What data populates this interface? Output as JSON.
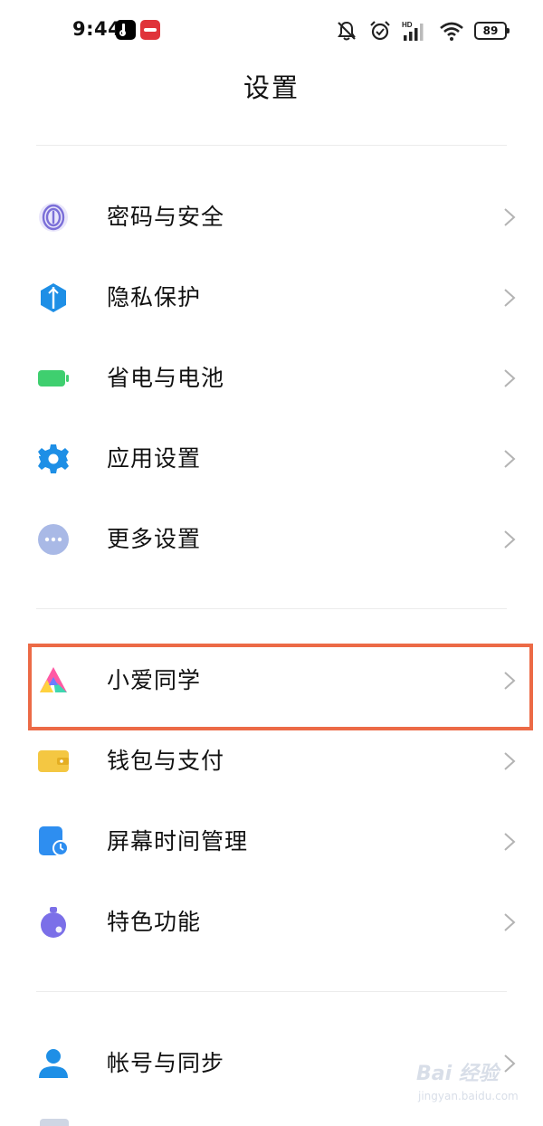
{
  "status_bar": {
    "time": "9:44",
    "battery_level": "89",
    "network_label": "HD",
    "icons": [
      "tiktok-icon",
      "app-icon",
      "mute-icon",
      "alarm-icon",
      "signal-icon",
      "wifi-icon",
      "battery-icon"
    ]
  },
  "header": {
    "title": "设置"
  },
  "settings": {
    "group1": [
      {
        "label": "密码与安全",
        "icon": "fingerprint-icon"
      },
      {
        "label": "隐私保护",
        "icon": "privacy-shield-icon"
      },
      {
        "label": "省电与电池",
        "icon": "battery-green-icon"
      },
      {
        "label": "应用设置",
        "icon": "app-gear-icon"
      },
      {
        "label": "更多设置",
        "icon": "more-dots-icon"
      }
    ],
    "group2": [
      {
        "label": "小爱同学",
        "icon": "xiaoai-icon",
        "highlighted": true
      },
      {
        "label": "钱包与支付",
        "icon": "wallet-icon"
      },
      {
        "label": "屏幕时间管理",
        "icon": "screen-time-icon"
      },
      {
        "label": "特色功能",
        "icon": "feature-icon"
      }
    ],
    "group3": [
      {
        "label": "帐号与同步",
        "icon": "account-icon"
      }
    ]
  },
  "colors": {
    "highlight_border": "#ec6a46",
    "fingerprint": "#7b6fd8",
    "privacy": "#1e8fe6",
    "battery": "#3fcf6f",
    "app_settings": "#1e8fe6",
    "more": "#a9b9e6",
    "wallet": "#f4c742",
    "screen_time": "#2e8ef0",
    "feature": "#7b6fe8",
    "account": "#1e8fe6"
  },
  "watermark": {
    "main": "Bai 经验",
    "sub": "jingyan.baidu.com"
  }
}
